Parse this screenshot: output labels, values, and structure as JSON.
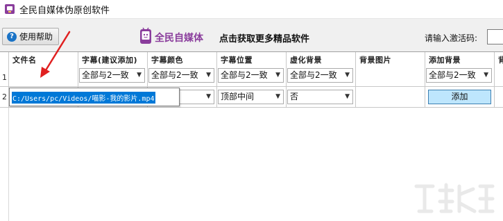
{
  "window": {
    "title": "全民自媒体伪原创软件"
  },
  "toolbar": {
    "help_label": "使用帮助",
    "brand_name": "全民自媒体",
    "promo_text": "点击获取更多精品软件",
    "activation_label": "请输入激活码:",
    "activation_value": ""
  },
  "grid": {
    "headers": [
      "文件名",
      "字幕(建议添加)",
      "字幕颜色",
      "字幕位置",
      "虚化背景",
      "背景图片",
      "添加背景",
      "背"
    ],
    "rows": [
      {
        "number": "1",
        "subtitle": "全部与2一致",
        "color": "全部与2一致",
        "position": "全部与2一致",
        "blur": "全部与2一致",
        "add_bg": "全部与2一致"
      },
      {
        "number": "2",
        "file_path": "C:/Users/pc/Videos/喵影-我的影片.mp4",
        "color": "",
        "position": "顶部中间",
        "blur": "否",
        "add_button": "添加"
      }
    ]
  },
  "colors": {
    "brand_purple": "#8a3d9c",
    "annotation_arrow": "#e02020",
    "selection_blue": "#0078d7",
    "add_button_fill": "#bee6fd"
  }
}
